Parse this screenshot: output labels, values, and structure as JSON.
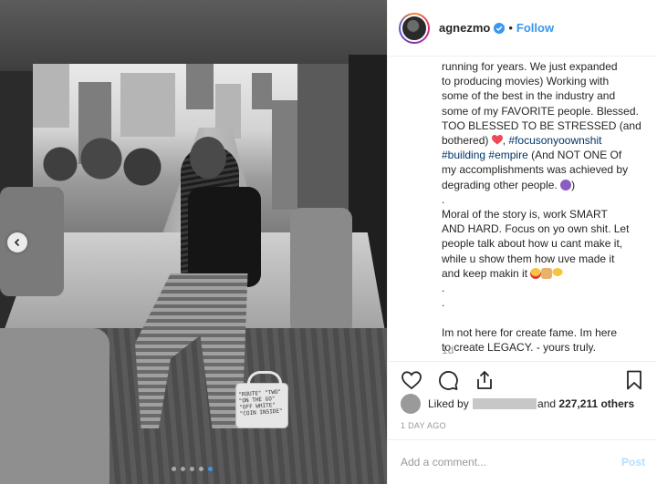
{
  "post": {
    "username": "agnezmo",
    "follow_label": "Follow",
    "separator": "•",
    "verified_icon": "verified-badge-icon",
    "avatar_icon": "profile-avatar",
    "caption_lines": [
      "running for years. We just expanded",
      "to producing movies) Working with",
      "some of the best in the industry and",
      "some of my FAVORITE people. Blessed.",
      "TOO BLESSED TO BE STRESSED (and"
    ],
    "caption_line6_prefix": "bothered)",
    "caption_line6_suffix": ",",
    "caption_tag1": "#focusonyoownshit",
    "caption_tag2": "#building",
    "caption_tag3": "#empire",
    "caption_line7_suffix": "(And NOT ONE Of",
    "caption_line8": "my accomplishments was achieved by",
    "caption_line9_prefix": "degrading other people.",
    "caption_line9_suffix": ")",
    "caption_dot1": ".",
    "caption_para2": [
      "Moral of the story is, work SMART",
      "AND HARD. Focus on yo own shit. Let",
      "people talk about how u cant make it,",
      "while u show them how uve made it"
    ],
    "caption_para2_last": "and keep makin it",
    "caption_dot2": ".",
    "caption_dot3": ".",
    "caption_para3": [
      "Im not here for create fame. Im here",
      "to create LEGACY. - yours truly."
    ],
    "time_ago": "1d",
    "likes": {
      "prefix": "Liked by",
      "suffix": "and",
      "count": "227,211 others"
    },
    "date": "1 DAY AGO",
    "comment": {
      "placeholder": "Add a comment...",
      "post_label": "Post"
    }
  },
  "photo": {
    "bag_text": "\"ROUTE\" \"TWO\" \"ON THE GO\" \"OFF WHITE\" \"COIN INSIDE\"",
    "carousel_dots": 5,
    "active_dot": 4
  },
  "colors": {
    "accent": "#3897f0",
    "text": "#262626",
    "muted": "#999999",
    "hashtag": "#003569",
    "post_disabled": "#b2dffc",
    "heart": "#ed4956"
  }
}
